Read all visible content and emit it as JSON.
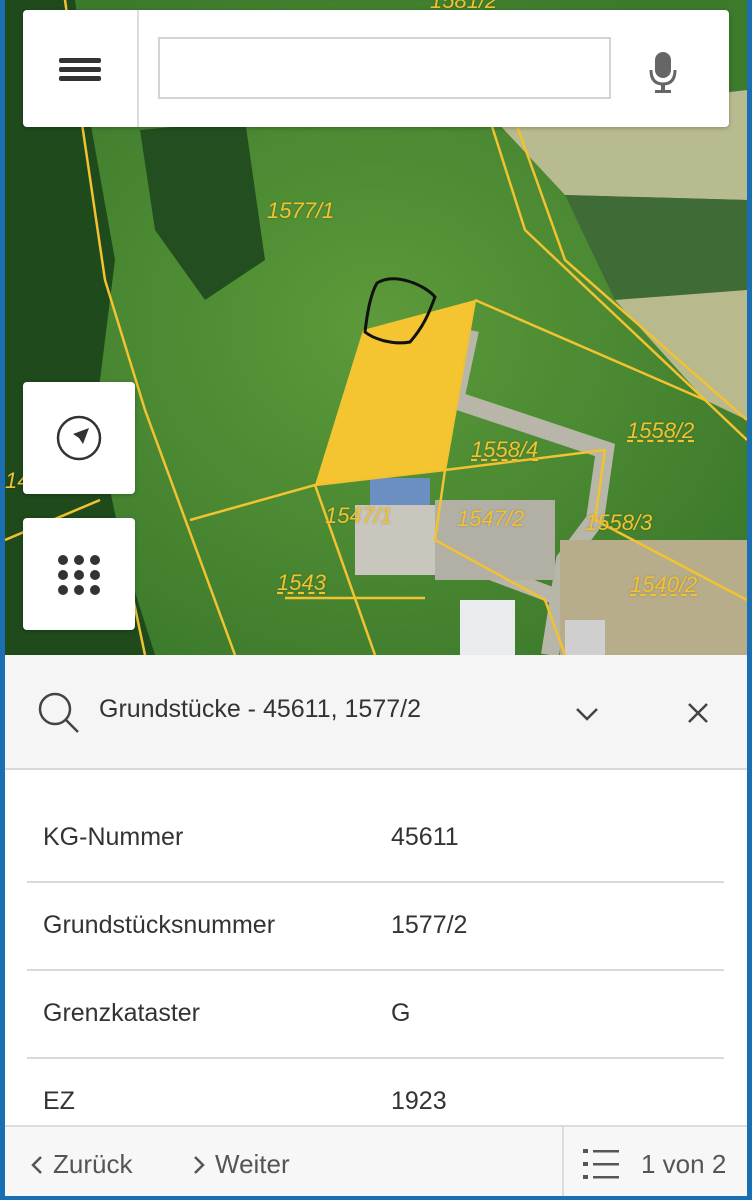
{
  "search": {
    "value": "",
    "placeholder": ""
  },
  "map": {
    "parcel_labels": [
      "1577/1",
      "1558/2",
      "1558/4",
      "1547/1",
      "1547/2",
      "1558/3",
      "1543",
      "1540/2",
      "1581/2",
      "14"
    ],
    "highlight_color": "#f5c431",
    "boundary_color": "#f2c230"
  },
  "result": {
    "title": "Grundstücke - 45611, 1577/2",
    "rows": [
      {
        "key": "KG-Nummer",
        "value": "45611"
      },
      {
        "key": "Grundstücksnummer",
        "value": "1577/2"
      },
      {
        "key": "Grenzkataster",
        "value": "G"
      },
      {
        "key": "EZ",
        "value": "1923"
      }
    ]
  },
  "footer": {
    "back_label": "Zurück",
    "next_label": "Weiter",
    "counter": "1 von 2"
  }
}
